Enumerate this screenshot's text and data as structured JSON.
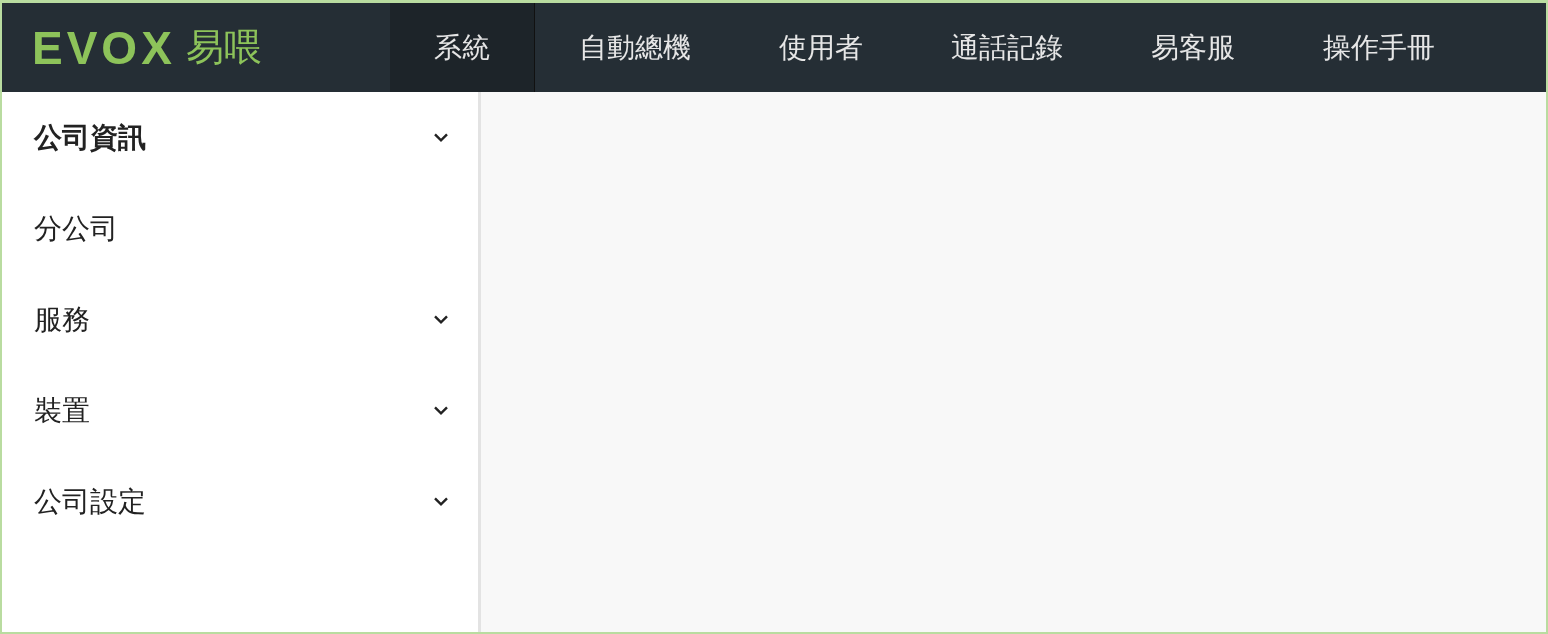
{
  "logo": {
    "wordmark": "EVOX",
    "name": "易喂"
  },
  "nav": [
    {
      "label": "系統",
      "selected": true
    },
    {
      "label": "自動總機",
      "selected": false
    },
    {
      "label": "使用者",
      "selected": false
    },
    {
      "label": "通話記錄",
      "selected": false
    },
    {
      "label": "易客服",
      "selected": false
    },
    {
      "label": "操作手冊",
      "selected": false
    }
  ],
  "sidebar": {
    "items": [
      {
        "label": "公司資訊",
        "kind": "group",
        "selected": true,
        "expanded": false
      },
      {
        "label": "分公司",
        "kind": "link",
        "selected": false
      },
      {
        "label": "服務",
        "kind": "group",
        "selected": false,
        "expanded": false
      },
      {
        "label": "裝置",
        "kind": "group",
        "selected": false,
        "expanded": false
      },
      {
        "label": "公司設定",
        "kind": "group",
        "selected": false,
        "expanded": false
      }
    ]
  }
}
